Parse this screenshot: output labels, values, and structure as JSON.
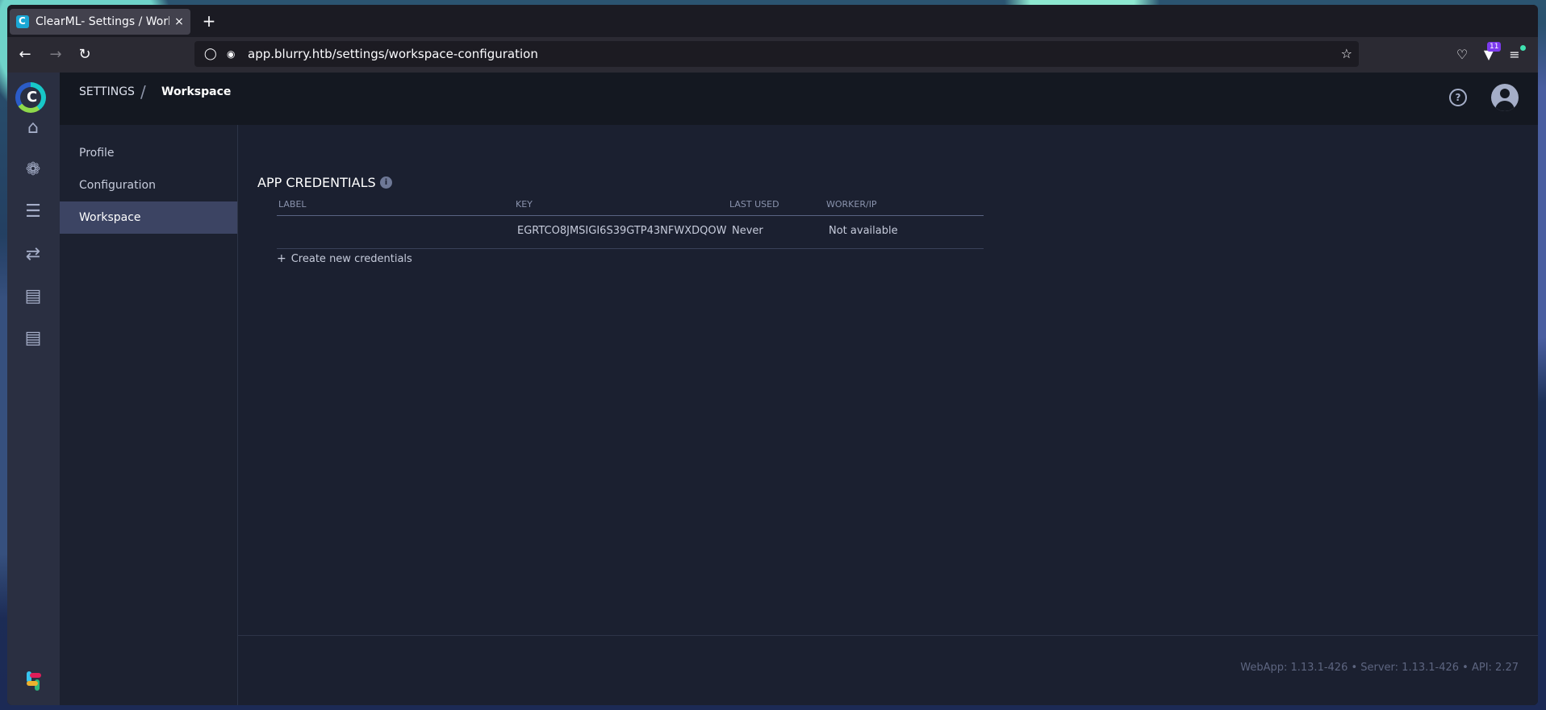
{
  "browser": {
    "tab_title": "ClearML- Settings / Workspace",
    "tab_close": "×",
    "new_tab": "+",
    "url": "app.blurry.htb/settings/workspace-configuration",
    "extension_badge": "11"
  },
  "header": {
    "breadcrumb_root": "SETTINGS",
    "breadcrumb_sep": "/",
    "breadcrumb_current": "Workspace"
  },
  "settings_menu": {
    "items": [
      {
        "label": "Profile"
      },
      {
        "label": "Configuration"
      },
      {
        "label": "Workspace"
      }
    ]
  },
  "credentials": {
    "title": "APP CREDENTIALS",
    "columns": [
      "LABEL",
      "KEY",
      "LAST USED",
      "WORKER/IP"
    ],
    "rows": [
      {
        "label": "",
        "key": "EGRTCO8JMSIGI6S39GTP43NFWXDQOW",
        "last_used": "Never",
        "worker_ip": "Not available"
      }
    ],
    "create_label": "Create new credentials"
  },
  "footer": {
    "version": "WebApp: 1.13.1-426 • Server: 1.13.1-426 • API: 2.27"
  },
  "colors": {
    "accent_active": "#3c4463",
    "sidebar": "#2a2f41",
    "header": "#141821"
  }
}
